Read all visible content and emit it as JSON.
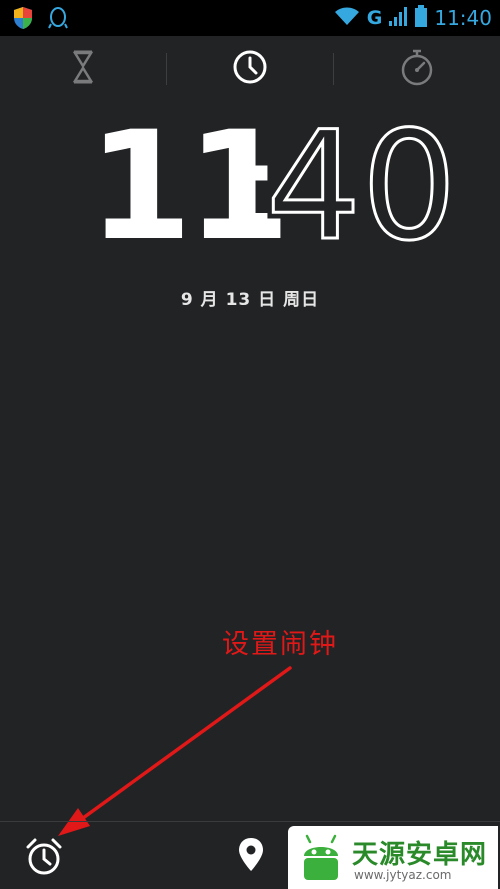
{
  "status_bar": {
    "network_type": "G",
    "time": "11:40",
    "icons": [
      "shield-app-icon",
      "qq-penguin-icon",
      "wifi-icon",
      "signal-icon",
      "battery-icon"
    ]
  },
  "tabs": [
    {
      "name": "timer",
      "icon": "hourglass-icon",
      "selected": false
    },
    {
      "name": "clock",
      "icon": "clock-icon",
      "selected": true
    },
    {
      "name": "stopwatch",
      "icon": "stopwatch-icon",
      "selected": false
    }
  ],
  "clock": {
    "hours": "11",
    "separator": ":",
    "minutes": "40",
    "date": "9 月 13 日 周日"
  },
  "annotation": {
    "text": "设置闹钟",
    "color": "#e01818"
  },
  "bottom_bar": {
    "alarm_icon": "alarm-clock-icon",
    "cities_icon": "location-pin-icon"
  },
  "watermark": {
    "title": "天源安卓网",
    "url": "www.jytyaz.com"
  },
  "colors": {
    "background": "#222325",
    "status_accent": "#36a8e0",
    "icon_active": "#ffffff",
    "icon_inactive": "#7a7b7d"
  }
}
